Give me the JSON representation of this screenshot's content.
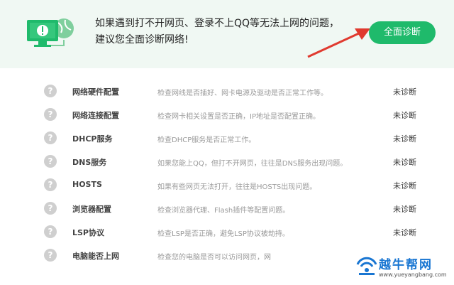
{
  "header": {
    "line1": "如果遇到打不开网页、登录不上QQ等无法上网的问题，",
    "line2": "建议您全面诊断网络!",
    "diagnose_button": "全面诊断"
  },
  "items": [
    {
      "name": "网络硬件配置",
      "desc": "检查网线是否插好、网卡电源及驱动是否正常工作等。",
      "status": "未诊断"
    },
    {
      "name": "网络连接配置",
      "desc": "检查网卡相关设置是否正确，IP地址是否配置正确。",
      "status": "未诊断"
    },
    {
      "name": "DHCP服务",
      "desc": "检查DHCP服务是否正常工作。",
      "status": "未诊断"
    },
    {
      "name": "DNS服务",
      "desc": "如果您能上QQ，但打不开网页，往往是DNS服务出现问题。",
      "status": "未诊断"
    },
    {
      "name": "HOSTS",
      "desc": "如果有些网页无法打开，往往是HOSTS出现问题。",
      "status": "未诊断"
    },
    {
      "name": "浏览器配置",
      "desc": "检查浏览器代理、Flash插件等配置问题。",
      "status": "未诊断"
    },
    {
      "name": "LSP协议",
      "desc": "检查LSP是否正确，避免LSP协议被劫持。",
      "status": "未诊断"
    },
    {
      "name": "电脑能否上网",
      "desc": "检查您的电脑是否可以访问网页，网",
      "status": ""
    }
  ],
  "watermark": {
    "title": "越牛帮网",
    "url": "www.yueyangbang.com"
  },
  "colors": {
    "accent": "#1fba6b",
    "header_bg": "#f0f8f3",
    "arrow": "#e03a2f"
  }
}
